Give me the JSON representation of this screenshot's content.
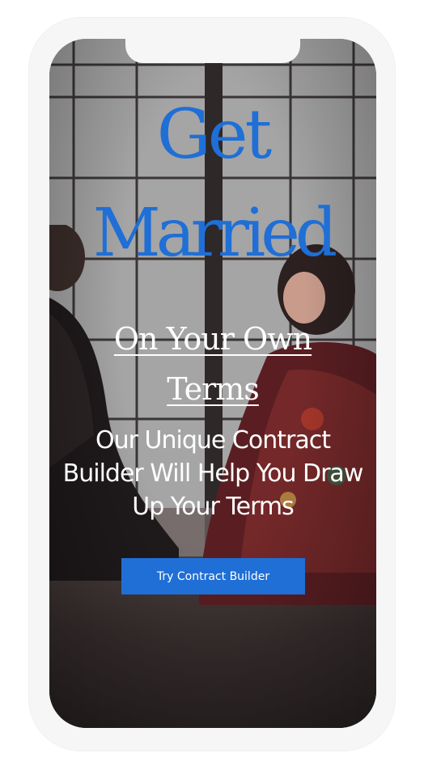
{
  "hero": {
    "headline_line1": "Get",
    "headline_line2": "Married",
    "subhead": "On Your Own Terms",
    "tagline": "Our Unique Contract Builder Will Help You Draw Up Your Terms",
    "cta_label": "Try Contract Builder"
  },
  "colors": {
    "accent": "#1f6fd6",
    "text_light": "#ffffff",
    "frame": "#f6f6f6"
  }
}
